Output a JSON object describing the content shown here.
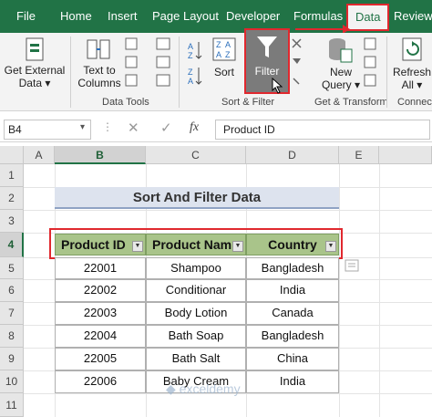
{
  "ribbon_tabs": [
    {
      "label": "File"
    },
    {
      "label": "Home"
    },
    {
      "label": "Insert"
    },
    {
      "label": "Page Layout"
    },
    {
      "label": "Developer"
    },
    {
      "label": "Formulas"
    },
    {
      "label": "Data"
    },
    {
      "label": "Review"
    }
  ],
  "active_tab": "Data",
  "ribbon": {
    "get_external_data": [
      "Get External",
      "Data ▾"
    ],
    "text_to_columns": [
      "Text to",
      "Columns"
    ],
    "sort": "Sort",
    "filter": "Filter",
    "new_query": [
      "New",
      "Query ▾"
    ],
    "refresh_all": [
      "Refresh",
      "All ▾"
    ],
    "groups": {
      "data_tools": "Data Tools",
      "sort_filter": "Sort & Filter",
      "get_transform": "Get & Transform",
      "connections": "Connecti"
    }
  },
  "formula_bar": {
    "name_box": "B4",
    "fx": "fx",
    "content": "Product ID"
  },
  "columns": [
    "A",
    "B",
    "C",
    "D",
    "E"
  ],
  "rows": [
    "1",
    "2",
    "3",
    "4",
    "5",
    "6",
    "7",
    "8",
    "9",
    "10",
    "11"
  ],
  "sheet": {
    "title": "Sort And Filter Data",
    "headers": [
      "Product ID",
      "Product Nam",
      "Country"
    ],
    "data": [
      [
        "22001",
        "Shampoo",
        "Bangladesh"
      ],
      [
        "22002",
        "Conditionar",
        "India"
      ],
      [
        "22003",
        "Body Lotion",
        "Canada"
      ],
      [
        "22004",
        "Bath Soap",
        "Bangladesh"
      ],
      [
        "22005",
        "Bath Salt",
        "China"
      ],
      [
        "22006",
        "Baby Cream",
        "India"
      ]
    ]
  },
  "watermark": "exceldemy",
  "colors": {
    "ribbon_green": "#217346",
    "header_fill": "#a9c48a",
    "title_fill": "#dde3ee",
    "highlight_red": "#e0282e"
  }
}
